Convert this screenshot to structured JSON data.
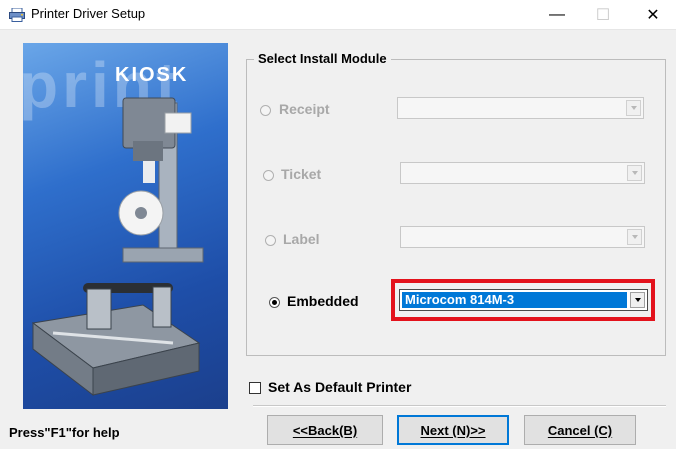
{
  "window": {
    "title": "Printer Driver Setup",
    "minimize_glyph": "—",
    "maximize_glyph": "☐",
    "close_glyph": "✕",
    "app_icon": "printer-icon"
  },
  "banner": {
    "brand": "KIOSK",
    "watermark": "print",
    "colors": {
      "top": "#6aa6e8",
      "bottom": "#1b3f8c"
    }
  },
  "help_text": "Press\"F1\"for help",
  "group": {
    "title": "Select Install Module",
    "options": [
      {
        "label": "Receipt",
        "checked": false,
        "enabled": false,
        "value": ""
      },
      {
        "label": "Ticket",
        "checked": false,
        "enabled": false,
        "value": ""
      },
      {
        "label": "Label",
        "checked": false,
        "enabled": false,
        "value": ""
      },
      {
        "label": "Embedded",
        "checked": true,
        "enabled": true,
        "value": "Microcom 814M-3"
      }
    ]
  },
  "default_printer": {
    "label": "Set As Default Printer",
    "checked": false
  },
  "buttons": {
    "back": "<<Back(B)",
    "next": "Next (N)>>",
    "cancel": "Cancel (C)"
  },
  "accent_colors": {
    "selection": "#0078d7",
    "highlight_box": "#e3121c"
  }
}
